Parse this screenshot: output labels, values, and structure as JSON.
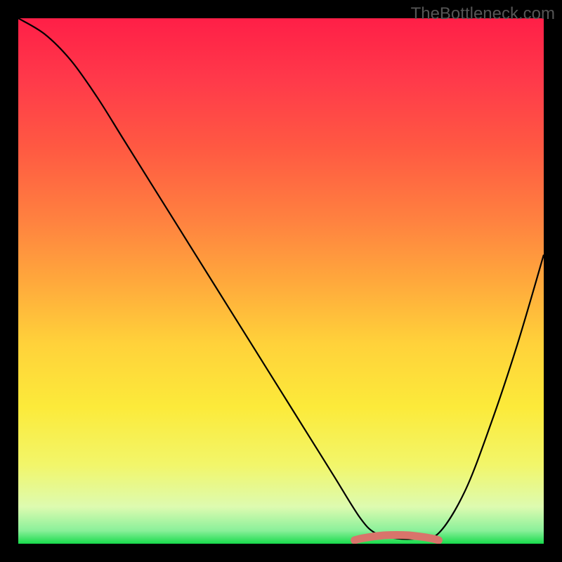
{
  "watermark": "TheBottleneck.com",
  "chart_data": {
    "type": "line",
    "title": "",
    "xlabel": "",
    "ylabel": "",
    "xlim": [
      0,
      100
    ],
    "ylim": [
      0,
      100
    ],
    "grid": false,
    "legend": false,
    "annotations": [],
    "series": [
      {
        "name": "bottleneck-curve",
        "color": "#000000",
        "x": [
          0,
          5,
          10,
          15,
          20,
          25,
          30,
          35,
          40,
          45,
          50,
          55,
          60,
          65,
          68,
          72,
          76,
          80,
          85,
          90,
          95,
          100
        ],
        "y": [
          100,
          97,
          92,
          85,
          77,
          69,
          61,
          53,
          45,
          37,
          29,
          21,
          13,
          5,
          2,
          1,
          1,
          2,
          10,
          23,
          38,
          55
        ]
      }
    ],
    "highlight": {
      "name": "optimal-range",
      "color": "#d9746b",
      "x_range": [
        64,
        80
      ],
      "y": 1.2
    },
    "background_gradient": {
      "stops": [
        {
          "pos": 0.0,
          "color": "#ff1f47"
        },
        {
          "pos": 0.12,
          "color": "#ff3a4a"
        },
        {
          "pos": 0.25,
          "color": "#ff5a42"
        },
        {
          "pos": 0.38,
          "color": "#ff8040"
        },
        {
          "pos": 0.5,
          "color": "#ffa83c"
        },
        {
          "pos": 0.62,
          "color": "#ffd23a"
        },
        {
          "pos": 0.74,
          "color": "#fcea3a"
        },
        {
          "pos": 0.85,
          "color": "#f2f66a"
        },
        {
          "pos": 0.93,
          "color": "#ddfbb0"
        },
        {
          "pos": 0.975,
          "color": "#8af09a"
        },
        {
          "pos": 1.0,
          "color": "#18db4c"
        }
      ]
    }
  }
}
